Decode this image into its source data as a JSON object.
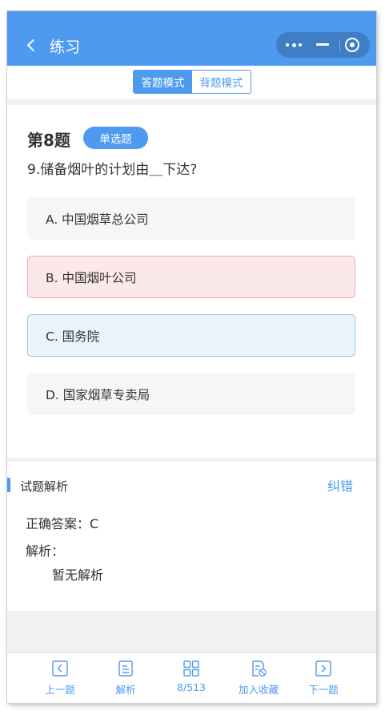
{
  "header": {
    "title": "练习",
    "back_icon": "chevron-left-icon",
    "capsule_icons": [
      "more-icon",
      "minus-icon",
      "target-icon"
    ],
    "bg_color": "#4e9aef"
  },
  "mode_toggle": {
    "answer_mode": "答题模式",
    "recite_mode": "背题模式",
    "active": "答题模式"
  },
  "question": {
    "number_label": "第8题",
    "type_badge": "单选题",
    "text": "9.储备烟叶的计划由＿下达?",
    "options": [
      {
        "label": "A. 中国烟草总公司",
        "state": "normal"
      },
      {
        "label": "B. 中国烟叶公司",
        "state": "wrong"
      },
      {
        "label": "C. 国务院",
        "state": "correct"
      },
      {
        "label": "D. 国家烟草专卖局",
        "state": "normal"
      }
    ]
  },
  "analysis": {
    "title": "试题解析",
    "correction_link": "纠错",
    "correct_answer": "正确答案：C",
    "analysis_label": "解析：",
    "analysis_body": "暂无解析"
  },
  "bottom_nav": {
    "items": [
      {
        "label": "上一题",
        "icon": "prev-icon"
      },
      {
        "label": "解析",
        "icon": "document-icon"
      },
      {
        "label": "8/513",
        "icon": "grid-icon"
      },
      {
        "label": "加入收藏",
        "icon": "favorite-icon"
      },
      {
        "label": "下一题",
        "icon": "next-icon"
      }
    ]
  },
  "colors": {
    "accent": "#4e9aef",
    "wrong_bg": "#fbe8e8",
    "correct_bg": "#e8f4fa"
  }
}
